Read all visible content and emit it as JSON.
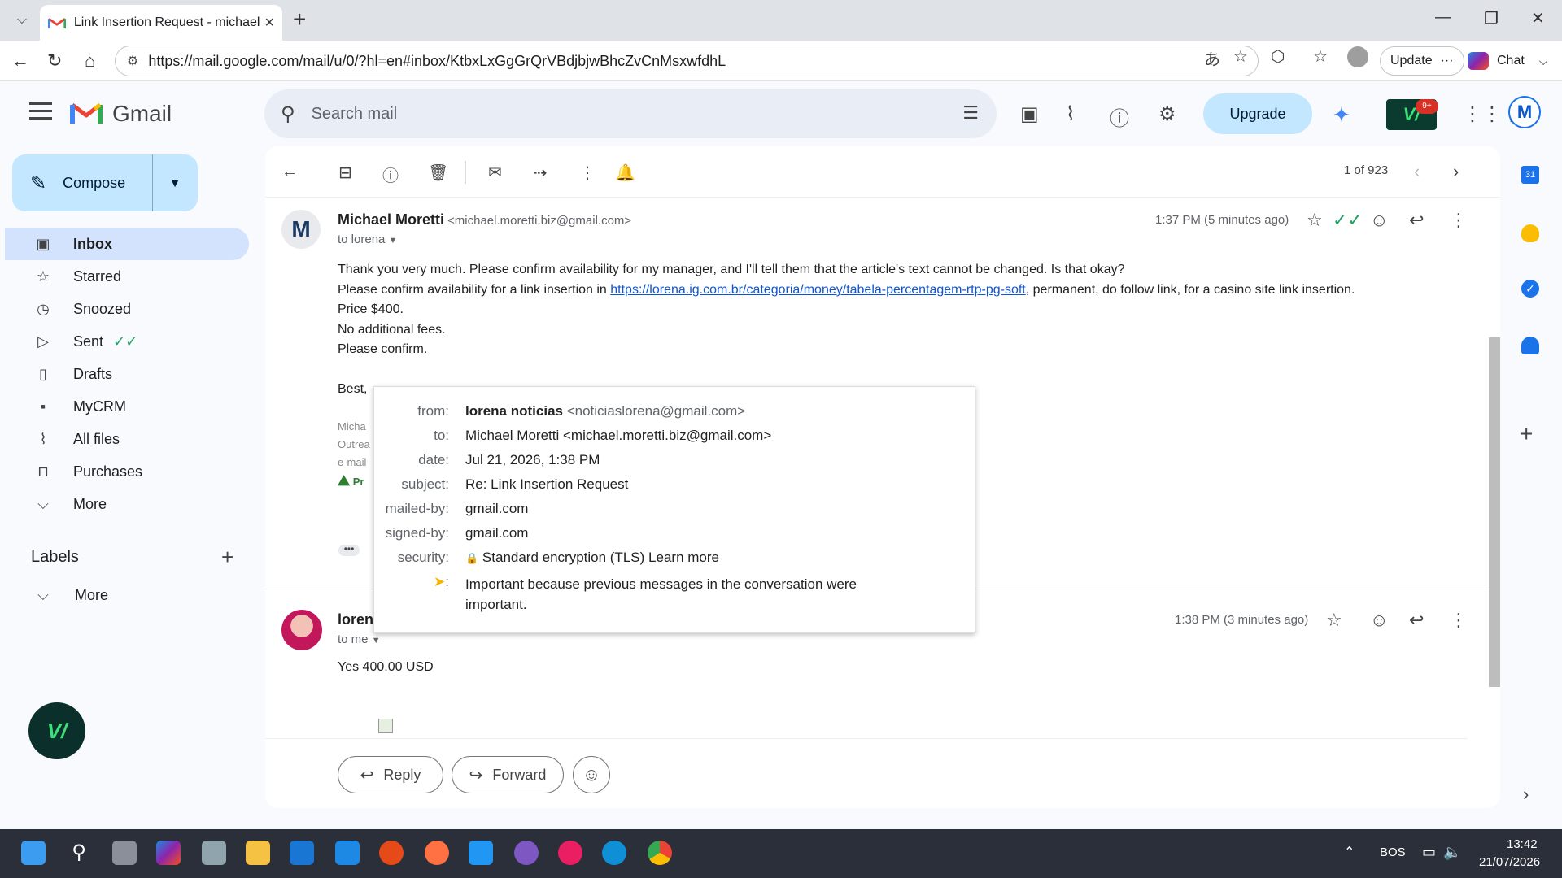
{
  "browser": {
    "tab_title": "Link Insertion Request - michael.m",
    "url": "https://mail.google.com/mail/u/0/?hl=en#inbox/KtbxLxGgGrQrVBdjbjwBhcZvCnMsxwfdhL",
    "update_label": "Update",
    "update_dots": "···",
    "chat_label": "Chat"
  },
  "gmail": {
    "app_name": "Gmail",
    "search_placeholder": "Search mail",
    "upgrade_label": "Upgrade",
    "avatar_letter": "M",
    "vbadge": "9+"
  },
  "sidebar": {
    "compose_label": "Compose",
    "items": [
      {
        "label": "Inbox",
        "icon": "inbox-icon"
      },
      {
        "label": "Starred",
        "icon": "star-icon"
      },
      {
        "label": "Snoozed",
        "icon": "clock-icon"
      },
      {
        "label": "Sent",
        "icon": "send-icon"
      },
      {
        "label": "Drafts",
        "icon": "draft-icon"
      },
      {
        "label": "MyCRM",
        "icon": "contact-card-icon"
      },
      {
        "label": "All files",
        "icon": "paperclip-icon"
      },
      {
        "label": "Purchases",
        "icon": "bag-icon"
      },
      {
        "label": "More",
        "icon": "chevron-down-icon"
      }
    ],
    "labels_title": "Labels",
    "labels_more": "More"
  },
  "toolbar": {
    "count": "1 of 923"
  },
  "message1": {
    "sender_name": "Michael Moretti",
    "sender_email": "<michael.moretti.biz@gmail.com>",
    "to": "to lorena",
    "time": "1:37 PM (5 minutes ago)",
    "line1": "Thank you very much. Please confirm availability for my manager, and I'll tell them that the article's text cannot be changed. Is that okay?",
    "line2_pre": "Please confirm availability for a link insertion in ",
    "line2_link": "https://lorena.ig.com.br/categoria/money/tabela-percentagem-rtp-pg-soft",
    "line2_post": ", permanent, do follow link, for a casino site link insertion.",
    "line3": "Price  $400.",
    "line4": "No additional fees.",
    "line5": "Please confirm.",
    "line6": "Best,",
    "sig1": "Micha",
    "sig2": "Outrea",
    "sig3": "e-mail",
    "sig4": "Pr"
  },
  "message2": {
    "sender_name": "loren",
    "to": "to me",
    "time": "1:38 PM (3 minutes ago)",
    "body": "Yes 400.00 USD"
  },
  "details_popup": {
    "from_label": "from:",
    "from_name": "lorena noticias",
    "from_email": "<noticiaslorena@gmail.com>",
    "to_label": "to:",
    "to_value": "Michael Moretti <michael.moretti.biz@gmail.com>",
    "date_label": "date:",
    "date_value": "Jul 21, 2026, 1:38 PM",
    "subject_label": "subject:",
    "subject_value": "Re: Link Insertion Request",
    "mailedby_label": "mailed-by:",
    "mailedby_value": "gmail.com",
    "signedby_label": "signed-by:",
    "signedby_value": "gmail.com",
    "security_label": "security:",
    "security_value": "Standard encryption (TLS)",
    "security_link": "Learn more",
    "important_label": ":",
    "important_value": "Important because previous messages in the conversation were important."
  },
  "actions": {
    "reply": "Reply",
    "forward": "Forward"
  },
  "side_panel": {
    "calendar_day": "31"
  },
  "taskbar": {
    "lang": "BOS",
    "time": "13:42",
    "date": "21/07/2026"
  }
}
